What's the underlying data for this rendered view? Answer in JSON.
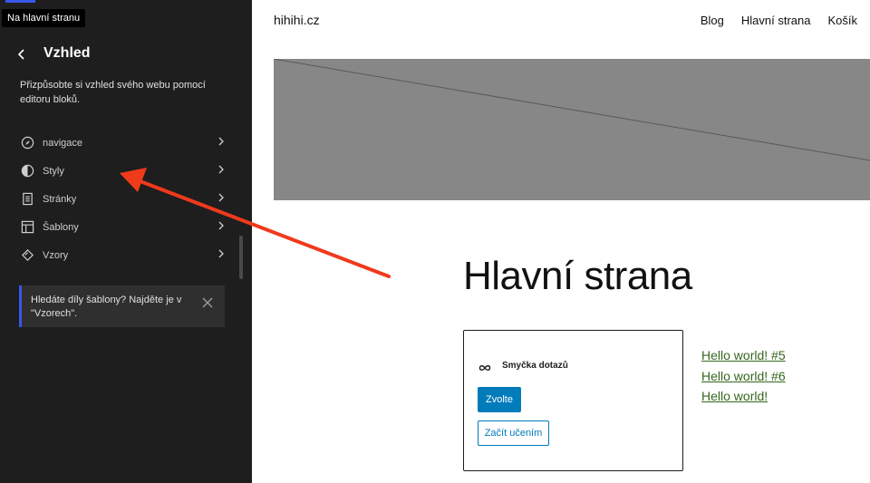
{
  "tooltip": "Na hlavní stranu",
  "sidebar": {
    "title": "Vzhled",
    "description": "Přizpůsobte si vzhled svého webu pomocí editoru bloků.",
    "items": [
      {
        "label": "navigace",
        "icon": "compass-icon"
      },
      {
        "label": "Styly",
        "icon": "half-circle-icon"
      },
      {
        "label": "Stránky",
        "icon": "page-icon"
      },
      {
        "label": "Šablony",
        "icon": "layout-icon"
      },
      {
        "label": "Vzory",
        "icon": "diamond-icon"
      }
    ],
    "notice": "Hledáte díly šablony? Najděte je v \"Vzorech\"."
  },
  "canvas": {
    "site_title": "hihihi.cz",
    "nav": [
      "Blog",
      "Hlavní strana",
      "Košík"
    ],
    "heading": "Hlavní strana",
    "query_loop": {
      "title": "Smyčka dotazů",
      "choose_label": "Zvolte",
      "start_label": "Začít učením"
    },
    "posts": [
      "Hello world! #5",
      "Hello world! #6",
      "Hello world!"
    ]
  },
  "colors": {
    "sidebar_bg": "#1e1e1e",
    "accent": "#3858e9",
    "button_blue": "#007cba",
    "link_green": "#35661d",
    "cover_gray": "#878787",
    "annotation_arrow": "#f03a1c"
  }
}
